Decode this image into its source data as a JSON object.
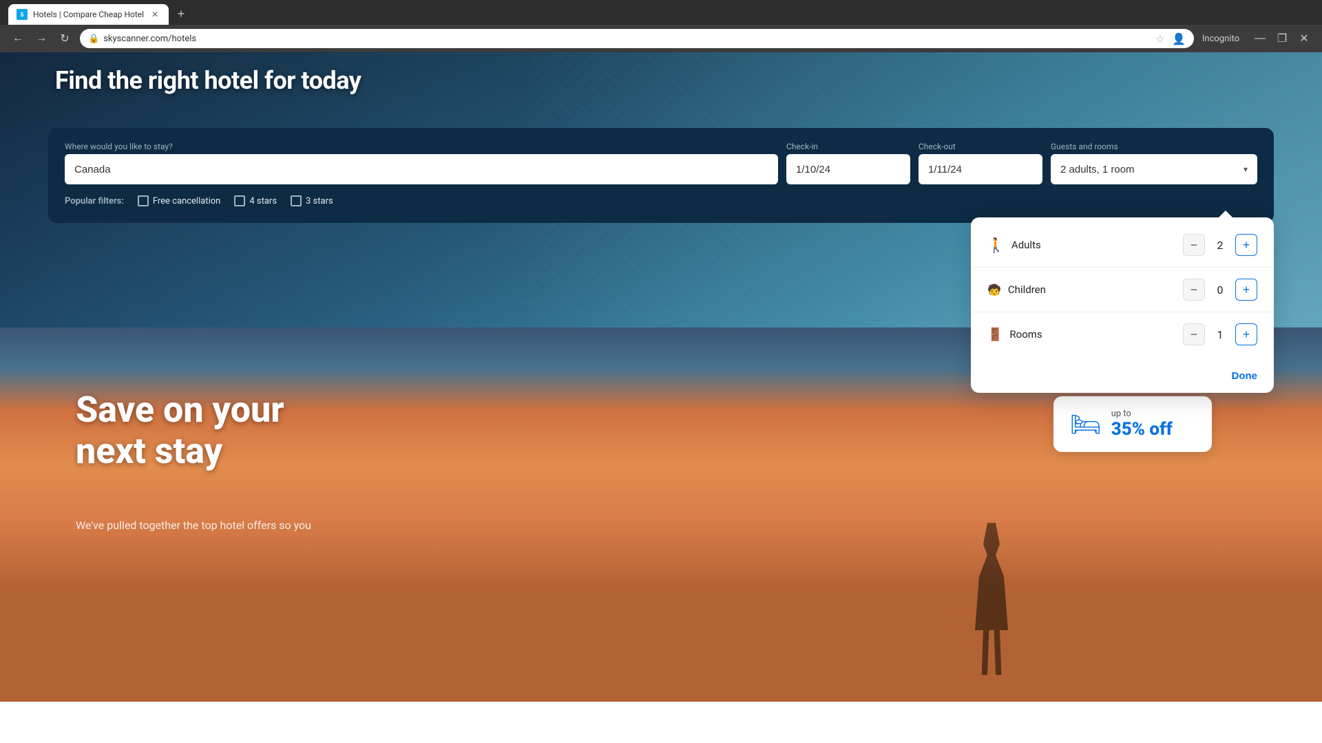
{
  "browser": {
    "tab_title": "Hotels | Compare Cheap Hotel",
    "url": "skyscanner.com/hotels",
    "favicon_label": "S",
    "new_tab_label": "+",
    "nav": {
      "back": "←",
      "forward": "→",
      "reload": "↻"
    },
    "window_controls": {
      "minimize": "—",
      "maximize": "❐",
      "close": "✕"
    },
    "incognito": "Incognito"
  },
  "search": {
    "destination_label": "Where would you like to stay?",
    "destination_value": "Canada",
    "destination_placeholder": "Where would you like to stay?",
    "checkin_label": "Check-in",
    "checkin_value": "1/10/24",
    "checkout_label": "Check-out",
    "checkout_value": "1/11/24",
    "guests_label": "Guests and rooms",
    "guests_value": "2 adults, 1 room",
    "filters_label": "Popular filters:",
    "filters": [
      {
        "id": "free-cancellation",
        "label": "Free cancellation"
      },
      {
        "id": "4-stars",
        "label": "4 stars"
      },
      {
        "id": "3-stars",
        "label": "3 stars"
      }
    ]
  },
  "guests_popup": {
    "adults_label": "Adults",
    "adults_value": 2,
    "adults_decrement": "−",
    "adults_increment": "+",
    "children_label": "Children",
    "children_value": 0,
    "children_decrement": "−",
    "children_increment": "+",
    "rooms_label": "Rooms",
    "rooms_value": 1,
    "rooms_decrement": "−",
    "rooms_increment": "+",
    "done_label": "Done"
  },
  "promo": {
    "headline_line1": "Save on your",
    "headline_line2": "next stay",
    "subtext": "We've pulled together the top hotel offers so you",
    "badge_up_to": "up to",
    "badge_percent": "35% off",
    "badge_icon": "🛏"
  },
  "icons": {
    "person_adult": "🚶",
    "person_child": "🧒",
    "door": "🚪",
    "chevron_down": "▾",
    "lock": "🔒",
    "star": "★"
  }
}
